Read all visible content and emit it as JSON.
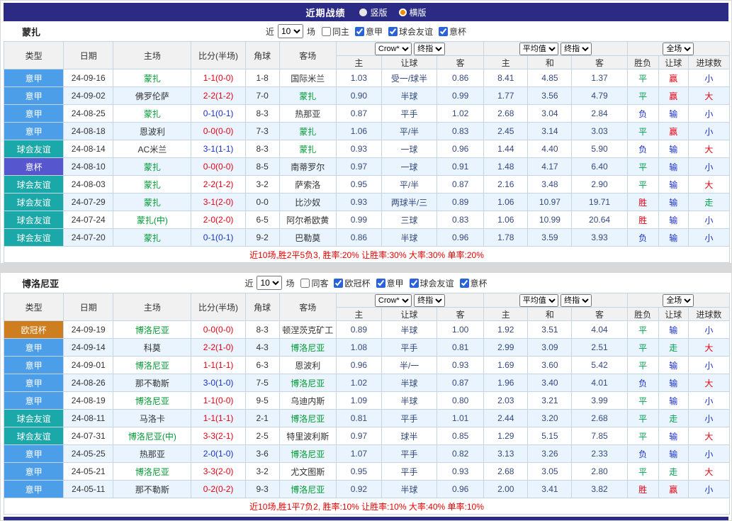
{
  "title_bar": {
    "title": "近期战绩",
    "radios": [
      {
        "label": "竖版",
        "selected": false
      },
      {
        "label": "横版",
        "selected": true
      }
    ]
  },
  "colors": {
    "title_bar_bg": "#2B2B85",
    "focal_team": "#009933",
    "alt_row_bg": "#E9F4FE",
    "summary_text": "#E60000"
  },
  "league_colors": {
    "意甲": "#4D9EE8",
    "球会友谊": "#1BA8A8",
    "意杯": "#5656CE",
    "欧冠杯": "#CE7D1F"
  },
  "result_colors": {
    "red": "#E60012",
    "blue": "#1A2FD0",
    "green": "#00A050"
  },
  "table_header": {
    "type": "类型",
    "date": "日期",
    "home": "主场",
    "score": "比分(半场)",
    "corner": "角球",
    "away": "客场",
    "odds_cols": [
      "主",
      "让球",
      "客"
    ],
    "avg_cols": [
      "主",
      "和",
      "客"
    ],
    "result_cols": [
      "胜负",
      "让球",
      "进球数"
    ]
  },
  "controls": {
    "provider": "Crow*",
    "final_odds": "终指",
    "average": "平均值",
    "full_match": "全场"
  },
  "sections": [
    {
      "team": "蒙扎",
      "filters": {
        "near": "近",
        "count": "10",
        "games": "场",
        "checkboxes": [
          {
            "label": "同主",
            "checked": false
          },
          {
            "label": "意甲",
            "checked": true
          },
          {
            "label": "球会友谊",
            "checked": true
          },
          {
            "label": "意杯",
            "checked": true
          }
        ]
      },
      "rows": [
        {
          "type": "意甲",
          "date": "24-09-16",
          "home": "蒙扎",
          "home_focal": true,
          "score": "1-1(0-0)",
          "score_color": "red",
          "corner": "1-8",
          "away": "国际米兰",
          "away_focal": false,
          "odds": [
            "1.03",
            "受一/球半",
            "0.86"
          ],
          "avg": [
            "8.41",
            "4.85",
            "1.37"
          ],
          "results": [
            {
              "t": "平",
              "c": "green"
            },
            {
              "t": "赢",
              "c": "red"
            },
            {
              "t": "小",
              "c": "blue"
            }
          ]
        },
        {
          "type": "意甲",
          "date": "24-09-02",
          "home": "佛罗伦萨",
          "home_focal": false,
          "score": "2-2(1-2)",
          "score_color": "red",
          "corner": "7-0",
          "away": "蒙扎",
          "away_focal": true,
          "odds": [
            "0.90",
            "半球",
            "0.99"
          ],
          "avg": [
            "1.77",
            "3.56",
            "4.79"
          ],
          "results": [
            {
              "t": "平",
              "c": "green"
            },
            {
              "t": "赢",
              "c": "red"
            },
            {
              "t": "大",
              "c": "red"
            }
          ]
        },
        {
          "type": "意甲",
          "date": "24-08-25",
          "home": "蒙扎",
          "home_focal": true,
          "score": "0-1(0-1)",
          "score_color": "blue",
          "corner": "8-3",
          "away": "热那亚",
          "away_focal": false,
          "odds": [
            "0.87",
            "平手",
            "1.02"
          ],
          "avg": [
            "2.68",
            "3.04",
            "2.84"
          ],
          "results": [
            {
              "t": "负",
              "c": "blue"
            },
            {
              "t": "输",
              "c": "blue"
            },
            {
              "t": "小",
              "c": "blue"
            }
          ]
        },
        {
          "type": "意甲",
          "date": "24-08-18",
          "home": "恩波利",
          "home_focal": false,
          "score": "0-0(0-0)",
          "score_color": "red",
          "corner": "7-3",
          "away": "蒙扎",
          "away_focal": true,
          "odds": [
            "1.06",
            "平/半",
            "0.83"
          ],
          "avg": [
            "2.45",
            "3.14",
            "3.03"
          ],
          "results": [
            {
              "t": "平",
              "c": "green"
            },
            {
              "t": "赢",
              "c": "red"
            },
            {
              "t": "小",
              "c": "blue"
            }
          ]
        },
        {
          "type": "球会友谊",
          "date": "24-08-14",
          "home": "AC米兰",
          "home_focal": false,
          "score": "3-1(1-1)",
          "score_color": "blue",
          "corner": "8-3",
          "away": "蒙扎",
          "away_focal": true,
          "odds": [
            "0.93",
            "一球",
            "0.96"
          ],
          "avg": [
            "1.44",
            "4.40",
            "5.90"
          ],
          "results": [
            {
              "t": "负",
              "c": "blue"
            },
            {
              "t": "输",
              "c": "blue"
            },
            {
              "t": "大",
              "c": "red"
            }
          ]
        },
        {
          "type": "意杯",
          "date": "24-08-10",
          "home": "蒙扎",
          "home_focal": true,
          "score": "0-0(0-0)",
          "score_color": "red",
          "corner": "8-5",
          "away": "南蒂罗尔",
          "away_focal": false,
          "odds": [
            "0.97",
            "一球",
            "0.91"
          ],
          "avg": [
            "1.48",
            "4.17",
            "6.40"
          ],
          "results": [
            {
              "t": "平",
              "c": "green"
            },
            {
              "t": "输",
              "c": "blue"
            },
            {
              "t": "小",
              "c": "blue"
            }
          ]
        },
        {
          "type": "球会友谊",
          "date": "24-08-03",
          "home": "蒙扎",
          "home_focal": true,
          "score": "2-2(1-2)",
          "score_color": "red",
          "corner": "3-2",
          "away": "萨索洛",
          "away_focal": false,
          "odds": [
            "0.95",
            "平/半",
            "0.87"
          ],
          "avg": [
            "2.16",
            "3.48",
            "2.90"
          ],
          "results": [
            {
              "t": "平",
              "c": "green"
            },
            {
              "t": "输",
              "c": "blue"
            },
            {
              "t": "大",
              "c": "red"
            }
          ]
        },
        {
          "type": "球会友谊",
          "date": "24-07-29",
          "home": "蒙扎",
          "home_focal": true,
          "score": "3-1(2-0)",
          "score_color": "red",
          "corner": "0-0",
          "away": "比沙奴",
          "away_focal": false,
          "odds": [
            "0.93",
            "两球半/三",
            "0.89"
          ],
          "avg": [
            "1.06",
            "10.97",
            "19.71"
          ],
          "results": [
            {
              "t": "胜",
              "c": "red"
            },
            {
              "t": "输",
              "c": "blue"
            },
            {
              "t": "走",
              "c": "green"
            }
          ]
        },
        {
          "type": "球会友谊",
          "date": "24-07-24",
          "home": "蒙扎(中)",
          "home_focal": true,
          "score": "2-0(2-0)",
          "score_color": "red",
          "corner": "6-5",
          "away": "阿尔希欧黄",
          "away_focal": false,
          "odds": [
            "0.99",
            "三球",
            "0.83"
          ],
          "avg": [
            "1.06",
            "10.99",
            "20.64"
          ],
          "results": [
            {
              "t": "胜",
              "c": "red"
            },
            {
              "t": "输",
              "c": "blue"
            },
            {
              "t": "小",
              "c": "blue"
            }
          ]
        },
        {
          "type": "球会友谊",
          "date": "24-07-20",
          "home": "蒙扎",
          "home_focal": true,
          "score": "0-1(0-1)",
          "score_color": "blue",
          "corner": "9-2",
          "away": "巴勒莫",
          "away_focal": false,
          "odds": [
            "0.86",
            "半球",
            "0.96"
          ],
          "avg": [
            "1.78",
            "3.59",
            "3.93"
          ],
          "results": [
            {
              "t": "负",
              "c": "blue"
            },
            {
              "t": "输",
              "c": "blue"
            },
            {
              "t": "小",
              "c": "blue"
            }
          ]
        }
      ],
      "summary": "近10场,胜2平5负3, 胜率:20% 让胜率:30% 大率:30% 单率:20%"
    },
    {
      "team": "博洛尼亚",
      "filters": {
        "near": "近",
        "count": "10",
        "games": "场",
        "checkboxes": [
          {
            "label": "同客",
            "checked": false
          },
          {
            "label": "欧冠杯",
            "checked": true
          },
          {
            "label": "意甲",
            "checked": true
          },
          {
            "label": "球会友谊",
            "checked": true
          },
          {
            "label": "意杯",
            "checked": true
          }
        ]
      },
      "rows": [
        {
          "type": "欧冠杯",
          "date": "24-09-19",
          "home": "博洛尼亚",
          "home_focal": true,
          "score": "0-0(0-0)",
          "score_color": "red",
          "corner": "8-3",
          "away": "顿涅茨克矿工",
          "away_focal": false,
          "odds": [
            "0.89",
            "半球",
            "1.00"
          ],
          "avg": [
            "1.92",
            "3.51",
            "4.04"
          ],
          "results": [
            {
              "t": "平",
              "c": "green"
            },
            {
              "t": "输",
              "c": "blue"
            },
            {
              "t": "小",
              "c": "blue"
            }
          ]
        },
        {
          "type": "意甲",
          "date": "24-09-14",
          "home": "科莫",
          "home_focal": false,
          "score": "2-2(1-0)",
          "score_color": "red",
          "corner": "4-3",
          "away": "博洛尼亚",
          "away_focal": true,
          "odds": [
            "1.08",
            "平手",
            "0.81"
          ],
          "avg": [
            "2.99",
            "3.09",
            "2.51"
          ],
          "results": [
            {
              "t": "平",
              "c": "green"
            },
            {
              "t": "走",
              "c": "green"
            },
            {
              "t": "大",
              "c": "red"
            }
          ]
        },
        {
          "type": "意甲",
          "date": "24-09-01",
          "home": "博洛尼亚",
          "home_focal": true,
          "score": "1-1(1-1)",
          "score_color": "red",
          "corner": "6-3",
          "away": "恩波利",
          "away_focal": false,
          "odds": [
            "0.96",
            "半/一",
            "0.93"
          ],
          "avg": [
            "1.69",
            "3.60",
            "5.42"
          ],
          "results": [
            {
              "t": "平",
              "c": "green"
            },
            {
              "t": "输",
              "c": "blue"
            },
            {
              "t": "小",
              "c": "blue"
            }
          ]
        },
        {
          "type": "意甲",
          "date": "24-08-26",
          "home": "那不勒斯",
          "home_focal": false,
          "score": "3-0(1-0)",
          "score_color": "blue",
          "corner": "7-5",
          "away": "博洛尼亚",
          "away_focal": true,
          "odds": [
            "1.02",
            "半球",
            "0.87"
          ],
          "avg": [
            "1.96",
            "3.40",
            "4.01"
          ],
          "results": [
            {
              "t": "负",
              "c": "blue"
            },
            {
              "t": "输",
              "c": "blue"
            },
            {
              "t": "大",
              "c": "red"
            }
          ]
        },
        {
          "type": "意甲",
          "date": "24-08-19",
          "home": "博洛尼亚",
          "home_focal": true,
          "score": "1-1(0-0)",
          "score_color": "red",
          "corner": "9-5",
          "away": "乌迪内斯",
          "away_focal": false,
          "odds": [
            "1.09",
            "半球",
            "0.80"
          ],
          "avg": [
            "2.03",
            "3.21",
            "3.99"
          ],
          "results": [
            {
              "t": "平",
              "c": "green"
            },
            {
              "t": "输",
              "c": "blue"
            },
            {
              "t": "小",
              "c": "blue"
            }
          ]
        },
        {
          "type": "球会友谊",
          "date": "24-08-11",
          "home": "马洛卡",
          "home_focal": false,
          "score": "1-1(1-1)",
          "score_color": "red",
          "corner": "2-1",
          "away": "博洛尼亚",
          "away_focal": true,
          "odds": [
            "0.81",
            "平手",
            "1.01"
          ],
          "avg": [
            "2.44",
            "3.20",
            "2.68"
          ],
          "results": [
            {
              "t": "平",
              "c": "green"
            },
            {
              "t": "走",
              "c": "green"
            },
            {
              "t": "小",
              "c": "blue"
            }
          ]
        },
        {
          "type": "球会友谊",
          "date": "24-07-31",
          "home": "博洛尼亚(中)",
          "home_focal": true,
          "score": "3-3(2-1)",
          "score_color": "red",
          "corner": "2-5",
          "away": "特里波利斯",
          "away_focal": false,
          "odds": [
            "0.97",
            "球半",
            "0.85"
          ],
          "avg": [
            "1.29",
            "5.15",
            "7.85"
          ],
          "results": [
            {
              "t": "平",
              "c": "green"
            },
            {
              "t": "输",
              "c": "blue"
            },
            {
              "t": "大",
              "c": "red"
            }
          ]
        },
        {
          "type": "意甲",
          "date": "24-05-25",
          "home": "热那亚",
          "home_focal": false,
          "score": "2-0(1-0)",
          "score_color": "blue",
          "corner": "3-6",
          "away": "博洛尼亚",
          "away_focal": true,
          "odds": [
            "1.07",
            "平手",
            "0.82"
          ],
          "avg": [
            "3.13",
            "3.26",
            "2.33"
          ],
          "results": [
            {
              "t": "负",
              "c": "blue"
            },
            {
              "t": "输",
              "c": "blue"
            },
            {
              "t": "小",
              "c": "blue"
            }
          ]
        },
        {
          "type": "意甲",
          "date": "24-05-21",
          "home": "博洛尼亚",
          "home_focal": true,
          "score": "3-3(2-0)",
          "score_color": "red",
          "corner": "3-2",
          "away": "尤文图斯",
          "away_focal": false,
          "odds": [
            "0.95",
            "平手",
            "0.93"
          ],
          "avg": [
            "2.68",
            "3.05",
            "2.80"
          ],
          "results": [
            {
              "t": "平",
              "c": "green"
            },
            {
              "t": "走",
              "c": "green"
            },
            {
              "t": "大",
              "c": "red"
            }
          ]
        },
        {
          "type": "意甲",
          "date": "24-05-11",
          "home": "那不勒斯",
          "home_focal": false,
          "score": "0-2(0-2)",
          "score_color": "red",
          "corner": "9-3",
          "away": "博洛尼亚",
          "away_focal": true,
          "odds": [
            "0.92",
            "半球",
            "0.96"
          ],
          "avg": [
            "2.00",
            "3.41",
            "3.82"
          ],
          "results": [
            {
              "t": "胜",
              "c": "red"
            },
            {
              "t": "赢",
              "c": "red"
            },
            {
              "t": "小",
              "c": "blue"
            }
          ]
        }
      ],
      "summary": "近10场,胜1平7负2, 胜率:10% 让胜率:10% 大率:40% 单率:10%"
    }
  ]
}
